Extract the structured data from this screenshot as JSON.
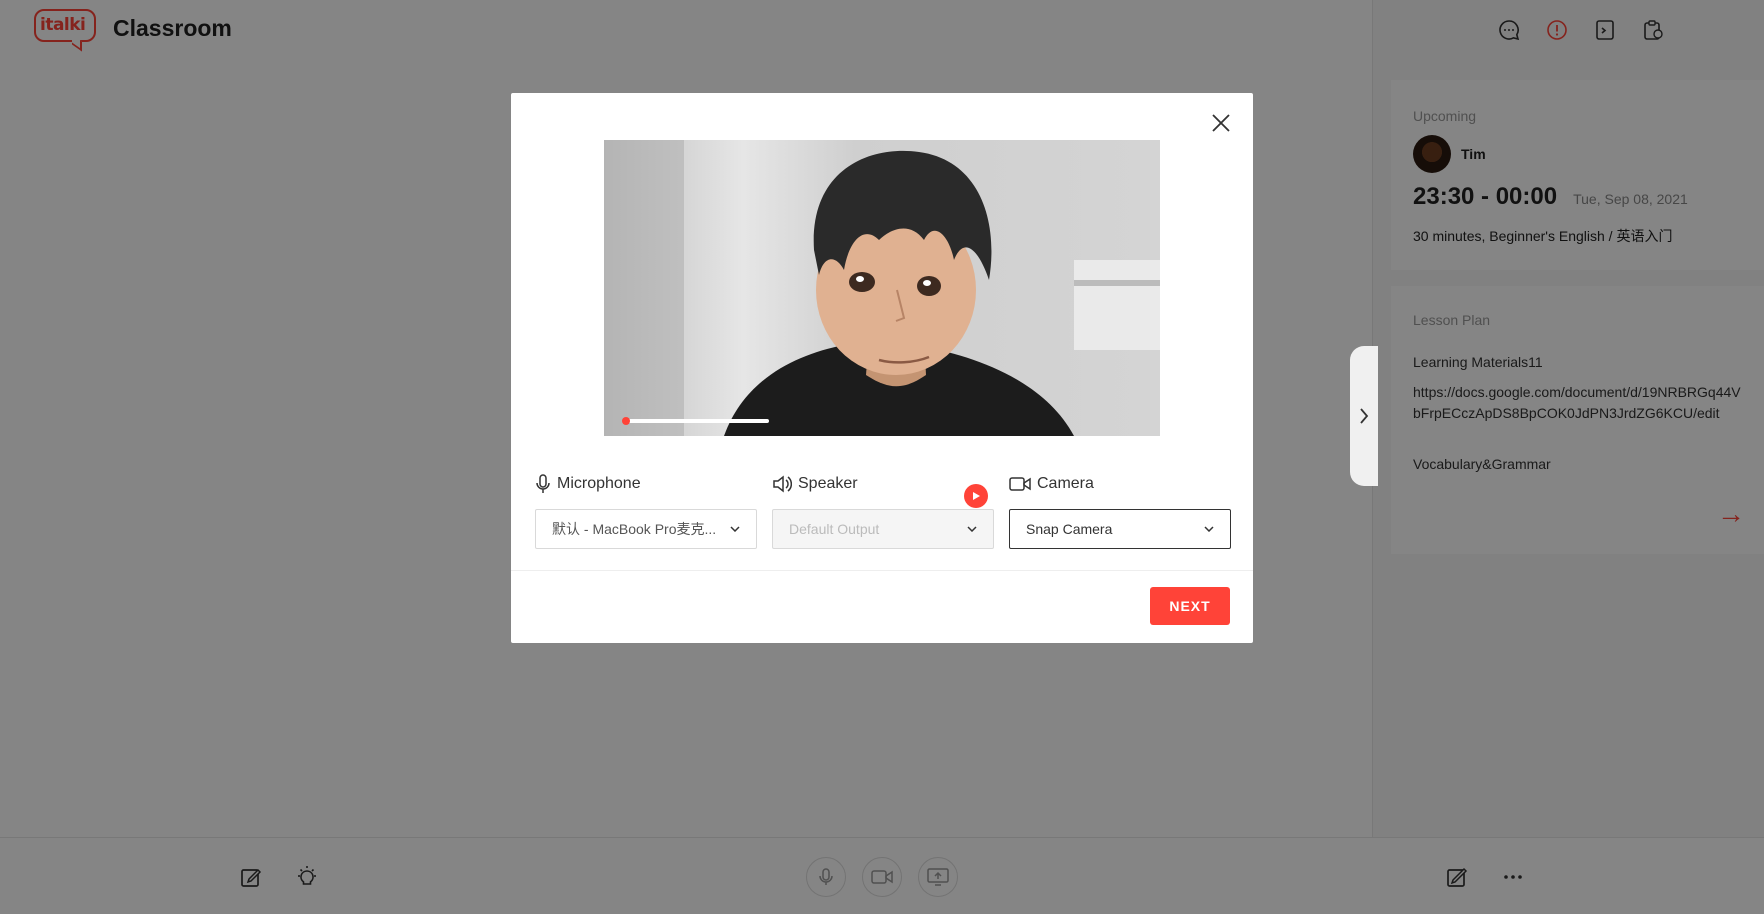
{
  "app": {
    "logo_text": "italki",
    "title": "Classroom"
  },
  "sidebar": {
    "icons": [
      "chat-icon",
      "alert-icon",
      "note-icon",
      "clipboard-icon"
    ],
    "upcoming": {
      "label": "Upcoming",
      "teacher": "Tim",
      "time": "23:30 - 00:00",
      "date": "Tue, Sep 08, 2021",
      "description": "30 minutes, Beginner's English / 英语入门"
    },
    "lesson_plan": {
      "label": "Lesson Plan",
      "items": [
        "Learning Materials11",
        "https://docs.google.com/document/d/19NRBRGq44VbFrpECczApDS8BpCOK0JdPN3JrdZG6KCU/edit",
        "Vocabulary&Grammar"
      ]
    }
  },
  "modal": {
    "preview_progress": 0.03,
    "microphone": {
      "label": "Microphone",
      "value": "默认 - MacBook Pro麦克..."
    },
    "speaker": {
      "label": "Speaker",
      "value": "Default Output"
    },
    "camera": {
      "label": "Camera",
      "value": "Snap Camera"
    },
    "next_label": "NEXT"
  },
  "colors": {
    "accent": "#ff4338"
  }
}
